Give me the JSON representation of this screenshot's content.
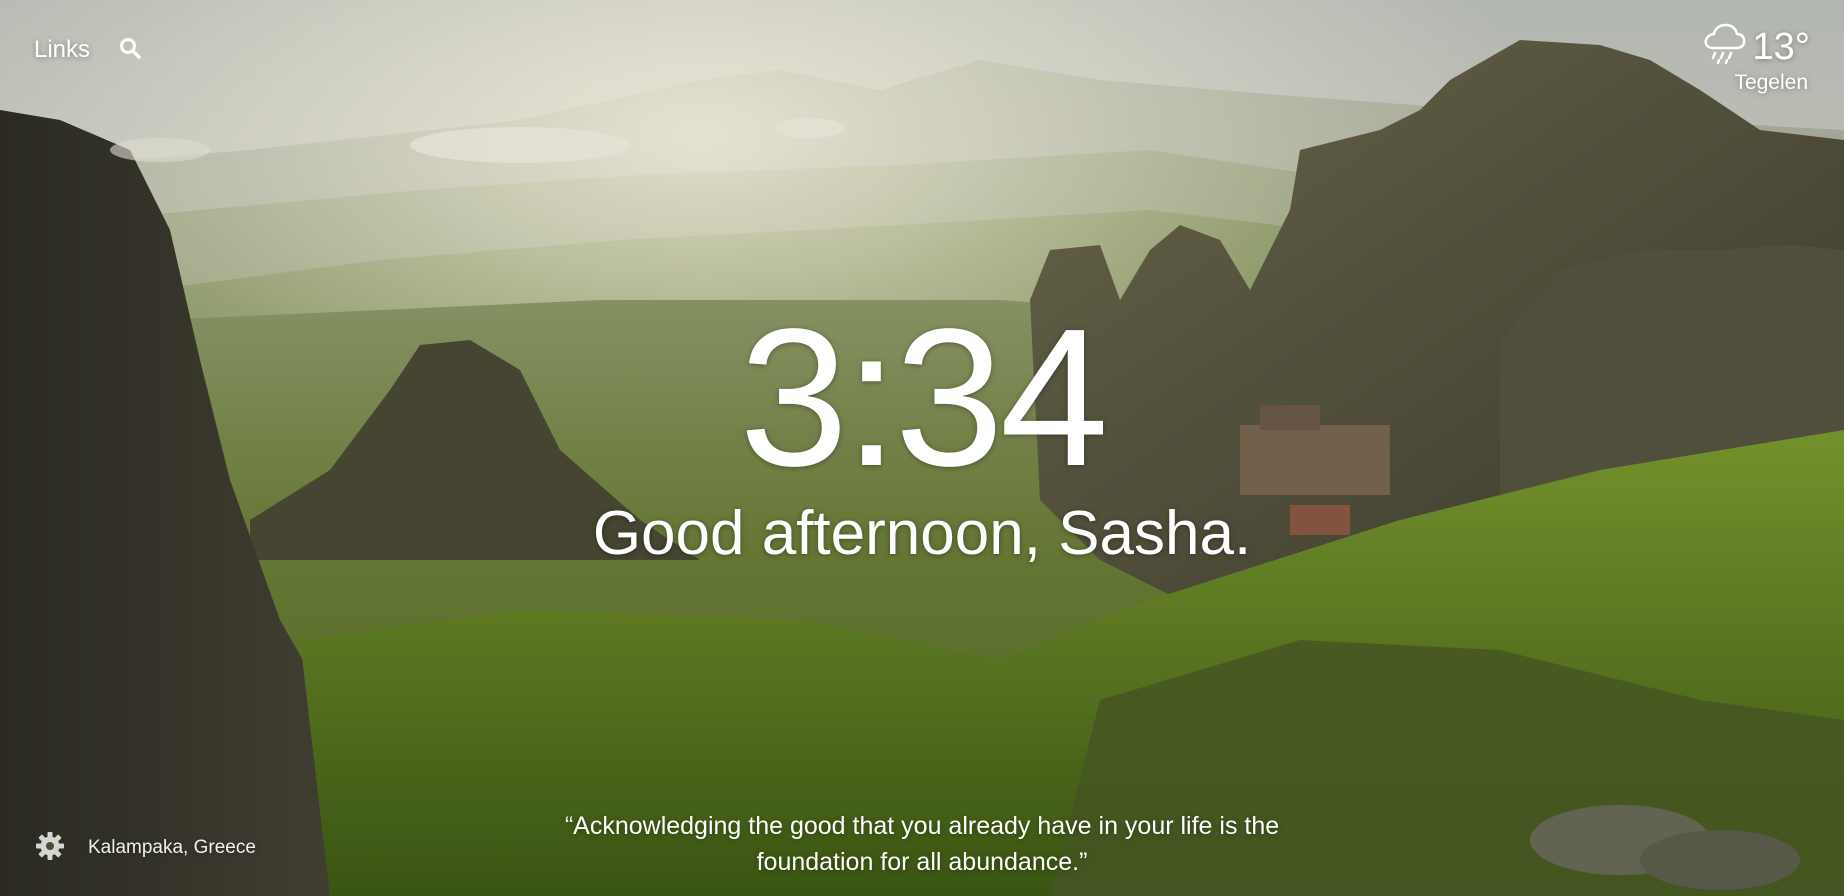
{
  "header": {
    "links_label": "Links",
    "search_icon": "search-icon"
  },
  "weather": {
    "icon": "rain-cloud-icon",
    "temperature": "13°",
    "location": "Tegelen"
  },
  "main": {
    "time": "3:34",
    "greeting": "Good afternoon, Sasha."
  },
  "footer": {
    "settings_icon": "gear-icon",
    "photo_location": "Kalampaka, Greece",
    "quote": "“Acknowledging the good that you already have in your life is the foundation for all abundance.”"
  },
  "colors": {
    "text": "#ffffff",
    "sky": "#c9cbc0",
    "foliage": "#5d7a25",
    "rock": "#3b3a30"
  }
}
